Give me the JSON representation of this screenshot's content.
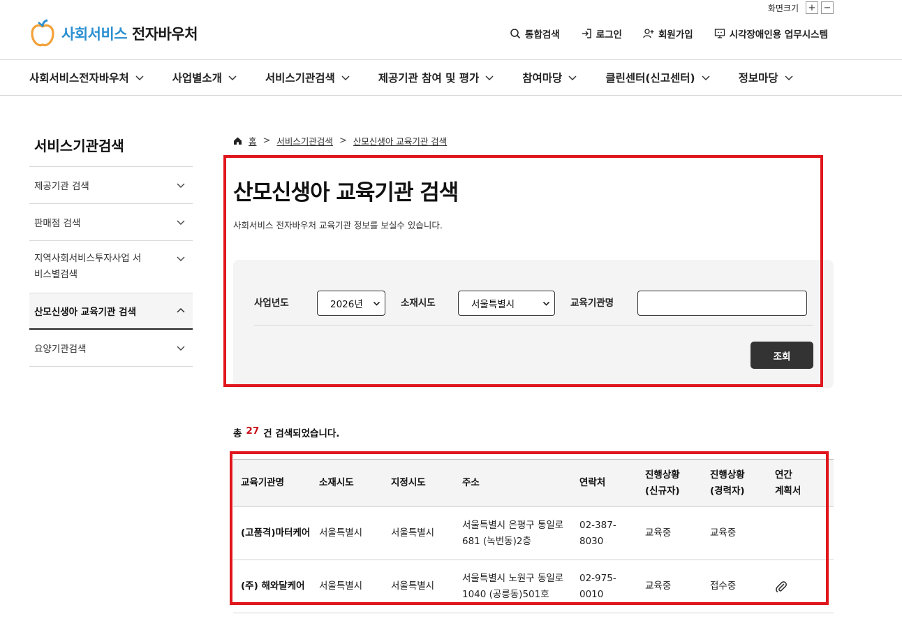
{
  "font_size": {
    "label": "화면크기",
    "plus": "+",
    "minus": "−"
  },
  "logo": {
    "part1": "사회서비스",
    "part2": "전자바우처",
    "brand_color": "#2a8fd1",
    "accent_color": "#f2a23a"
  },
  "util_nav": [
    {
      "label": "통합검색",
      "icon": "search-icon"
    },
    {
      "label": "로그인",
      "icon": "login-icon"
    },
    {
      "label": "회원가입",
      "icon": "user-add-icon"
    },
    {
      "label": "시각장애인용 업무시스템",
      "icon": "monitor-icon"
    }
  ],
  "gnb": [
    {
      "label": "사회서비스전자바우처"
    },
    {
      "label": "사업별소개"
    },
    {
      "label": "서비스기관검색"
    },
    {
      "label": "제공기관 참여 및 평가"
    },
    {
      "label": "참여마당"
    },
    {
      "label": "클린센터(신고센터)"
    },
    {
      "label": "정보마당"
    }
  ],
  "side": {
    "title": "서비스기관검색",
    "items": [
      {
        "label": "제공기관 검색"
      },
      {
        "label": "판매점 검색"
      },
      {
        "label": "지역사회서비스투자사업 서비스별검색"
      },
      {
        "label": "산모신생아 교육기관 검색"
      },
      {
        "label": "요양기관검색"
      }
    ]
  },
  "breadcrumb": {
    "home": "홈",
    "level1": "서비스기관검색",
    "level2": "산모신생아 교육기관 검색"
  },
  "page": {
    "title": "산모신생아 교육기관 검색",
    "description": "사회서비스 전자바우처 교육기관 정보를 보실수 있습니다."
  },
  "search": {
    "year_label": "사업년도",
    "year_value": "2026년",
    "region_label": "소재시도",
    "region_value": "서울특별시",
    "name_label": "교육기관명",
    "name_value": "",
    "button": "조회"
  },
  "results": {
    "prefix": "총",
    "count": "27",
    "suffix": "건 검색되었습니다."
  },
  "table": {
    "headers": [
      "교육기관명",
      "소재시도",
      "지정시도",
      "주소",
      "연락처",
      "진행상황\n(신규자)",
      "진행상황\n(경력자)",
      "연간\n계획서"
    ],
    "rows": [
      {
        "name": "(고품격)마터케어",
        "region": "서울특별시",
        "designated": "서울특별시",
        "address": "서울특별시 은평구 통일로 681 (녹번동)2층",
        "phone": "02-387-8030",
        "status_new": "교육중",
        "status_exp": "교육중",
        "plan": ""
      },
      {
        "name": "(주) 해와달케어",
        "region": "서울특별시",
        "designated": "서울특별시",
        "address": "서울특별시 노원구 동일로 1040 (공릉동)501호",
        "phone": "02-975-0010",
        "status_new": "교육중",
        "status_exp": "접수중",
        "plan": "attachment-icon"
      }
    ]
  }
}
